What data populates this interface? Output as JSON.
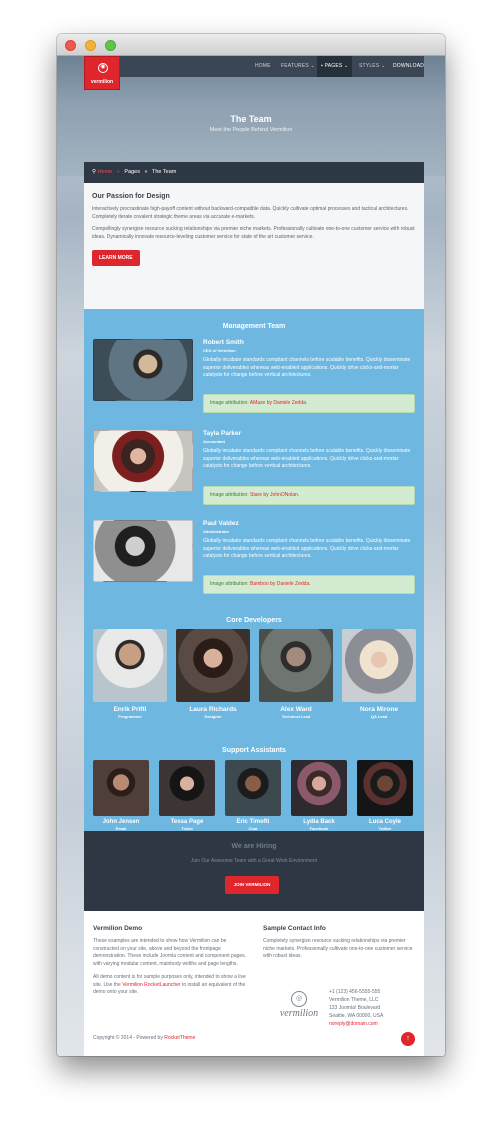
{
  "nav": {
    "items": [
      {
        "label": "HOME"
      },
      {
        "label": "FEATURES"
      },
      {
        "label": "PAGES"
      },
      {
        "label": "STYLES"
      },
      {
        "label": "DOWNLOAD"
      }
    ],
    "logo_text": "vermilion"
  },
  "hero": {
    "title": "The Team",
    "subtitle": "Meet the People Behind Vermilion"
  },
  "breadcrumb": {
    "items": [
      "Home",
      "Pages",
      "The Team"
    ]
  },
  "passion": {
    "title": "Our Passion for Design",
    "p1": "Interactively procrastinate high-payoff content without backward-compatible data. Quickly cultivate optimal processes and tactical architectures. Completely iterate covalent strategic theme areas via accurate e-markets.",
    "p2": "Compellingly synergize resource sucking relationships via premier niche markets. Professionally cultivate one-to-one customer service with robust ideas. Dynamically innovate resource-leveling customer service for state of the art customer service.",
    "button": "LEARN MORE"
  },
  "management": {
    "title": "Management Team",
    "members": [
      {
        "name": "Robert Smith",
        "role": "CEO of Vermilion",
        "bio": "Globally incubate standards compliant channels before scalable benefits. Quickly disseminate superior deliverables whereas web-enabled applications. Quickly drive clicks-and-mortar catalysts for change before vertical architectures.",
        "attr_prefix": "Image attribution: ",
        "attr_link": "AMaze by Daniele Zedda",
        "attr_suffix": "."
      },
      {
        "name": "Tayla Parker",
        "role": "Accountant",
        "bio": "Globally incubate standards compliant channels before scalable benefits. Quickly disseminate superior deliverables whereas web-enabled applications. Quickly drive clicks-and-mortar catalysts for change before vertical architectures.",
        "attr_prefix": "Image attribution: ",
        "attr_link": "Stare by JohnONolan",
        "attr_suffix": "."
      },
      {
        "name": "Paul Valdez",
        "role": "Administrator",
        "bio": "Globally incubate standards compliant channels before scalable benefits. Quickly disseminate superior deliverables whereas web-enabled applications. Quickly drive clicks-and-mortar catalysts for change before vertical architectures.",
        "attr_prefix": "Image attribution: ",
        "attr_link": "Bamboo by Daniele Zedda",
        "attr_suffix": "."
      }
    ]
  },
  "developers": {
    "title": "Core Developers",
    "members": [
      {
        "name": "Enrik Prifti",
        "role": "Programmer"
      },
      {
        "name": "Laura Richards",
        "role": "Designer"
      },
      {
        "name": "Alex Ward",
        "role": "Technical Lead"
      },
      {
        "name": "Nora Mirone",
        "role": "QA Lead"
      }
    ]
  },
  "support": {
    "title": "Support Assistants",
    "members": [
      {
        "name": "John Jensen",
        "role": "Email"
      },
      {
        "name": "Tessa Page",
        "role": "Ticket"
      },
      {
        "name": "Eric Timofti",
        "role": "Chat"
      },
      {
        "name": "Lydia Back",
        "role": "Facebook"
      },
      {
        "name": "Luca Coyle",
        "role": "Twitter"
      }
    ]
  },
  "hiring": {
    "title": "We are Hiring",
    "subtitle": "Join Our Awesome Team with a Great Work Environment",
    "button": "JOIN VERMILION"
  },
  "footer": {
    "demo_title": "Vermilion Demo",
    "demo_p1": "These examples are intended to show how Vermilion can be constructed on your site, above and beyond the frontpage demonstration. These include Joomla content and component pages, with varying modular content, mainbody widths and page lengths.",
    "demo_p2a": "All demo content is for sample purposes only, intended to show a live site. Use the ",
    "demo_link": "Vermilion RocketLauncher",
    "demo_p2b": " to install an equivalent of the demo onto your site.",
    "contact_title": "Sample Contact Info",
    "contact_p": "Completely synergize resource sucking relationships via premier niche markets. Professionally cultivate one-to-one customer service with robust ideas.",
    "logo_text": "vermilion",
    "phone": "+1 (123) 456-5555-555",
    "company": "Vermilion Theme, LLC",
    "street": "123 Joomla! Boulevard",
    "city": "Seattle, WA 00000, USA",
    "email": "noreply@domain.com",
    "copyright_prefix": "Copyright © 2014 - Powered by ",
    "copyright_link": "RocketTheme"
  },
  "colors": {
    "accent": "#e0262d",
    "team_bg": "#6db7e1",
    "dark": "#2d3844"
  }
}
